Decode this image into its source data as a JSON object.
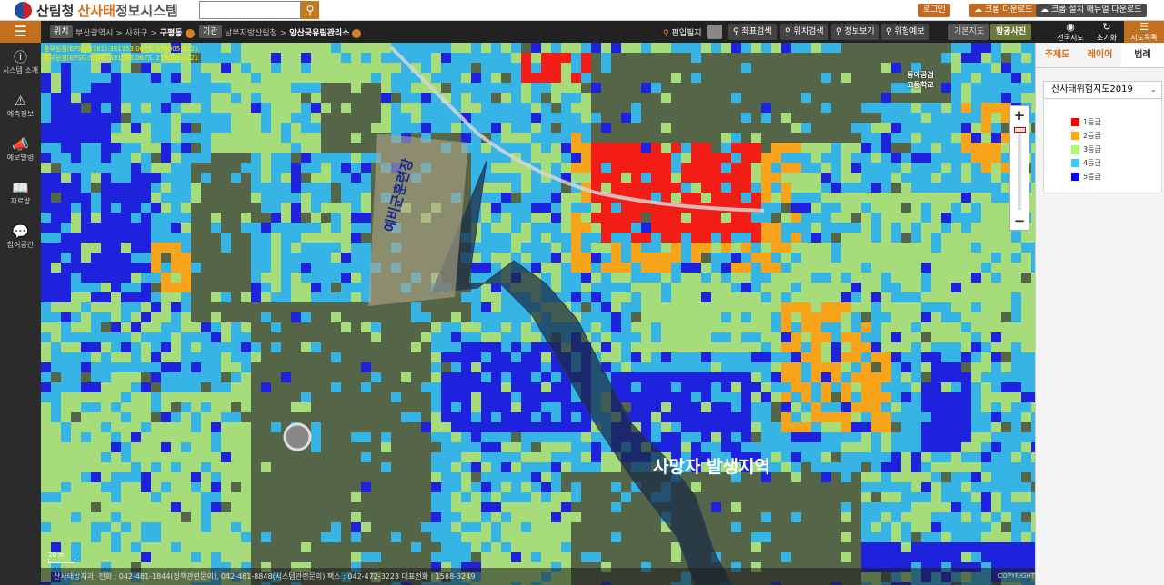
{
  "header": {
    "org": "산림청",
    "system_prefix": "산사태",
    "system_suffix": "정보시스템",
    "search_placeholder": "",
    "login_label": "로그인",
    "chrome_download_label": "크롬 다운로드",
    "chrome_manual_label": "크롬 설치 매뉴얼 다운로드"
  },
  "nav": {
    "location_tag": "위치",
    "location_path": "부산광역시 > 사하구 > ",
    "location_current": "구평동",
    "agency_tag": "기관",
    "agency_path": "남부지방산림청 > ",
    "agency_current": "양산국유림관리소",
    "tools": {
      "edit": "편입필지",
      "coord_search": "좌표검색",
      "location_search": "위치검색",
      "info_view": "정보보기",
      "risk_forecast": "위험예보"
    },
    "basemaps": [
      "기본지도",
      "항공사진"
    ],
    "basemap_active": "항공사진",
    "right_tools": [
      {
        "label": "전국지도",
        "icon": "eye-icon"
      },
      {
        "label": "초기화",
        "icon": "refresh-icon"
      },
      {
        "label": "지도목록",
        "icon": "list-icon"
      }
    ]
  },
  "sidebar": {
    "items": [
      {
        "label": "시스템 소개",
        "icon": "info-icon"
      },
      {
        "label": "예측정보",
        "icon": "alert-icon"
      },
      {
        "label": "예보발령",
        "icon": "megaphone-icon"
      },
      {
        "label": "자료방",
        "icon": "book-icon"
      },
      {
        "label": "참여공간",
        "icon": "chat-icon"
      }
    ]
  },
  "map": {
    "coord_lines": [
      "중부원점(EPSG:5181):381353.0675, 179005.0221",
      "중부원점(EPSG:5186):381353.0675, 279005.0221"
    ],
    "label_training_ground": "예비군훈련장",
    "label_casualty_area": "사망자 발생지역",
    "label_school": "동아공업고등학교",
    "scale_label": "20 m",
    "footer": "산사태방지과, 전화 : 042-481-1844(정책관련문의), 042-481-8848(시스템관련문의) 팩스 : 042-472-3223 대표전화 : 1588-3249",
    "copyright": "COPYRIGHT"
  },
  "panel": {
    "tabs": [
      "주제도",
      "레이어",
      "범례"
    ],
    "active_tab": "범례",
    "legend_select": "산사태위험지도2019",
    "legend": [
      {
        "label": "1등급",
        "color": "#ff0000"
      },
      {
        "label": "2등급",
        "color": "#ffaa00"
      },
      {
        "label": "3등급",
        "color": "#aaff66"
      },
      {
        "label": "4등급",
        "color": "#33ccff"
      },
      {
        "label": "5등급",
        "color": "#0000ff"
      }
    ]
  },
  "colors": {
    "accent": "#c2701e",
    "grade1": "#f21d17",
    "grade2": "#f8a41b",
    "grade3": "#a6dc7a",
    "grade4": "#36b4e6",
    "grade5": "#1f22dc"
  }
}
